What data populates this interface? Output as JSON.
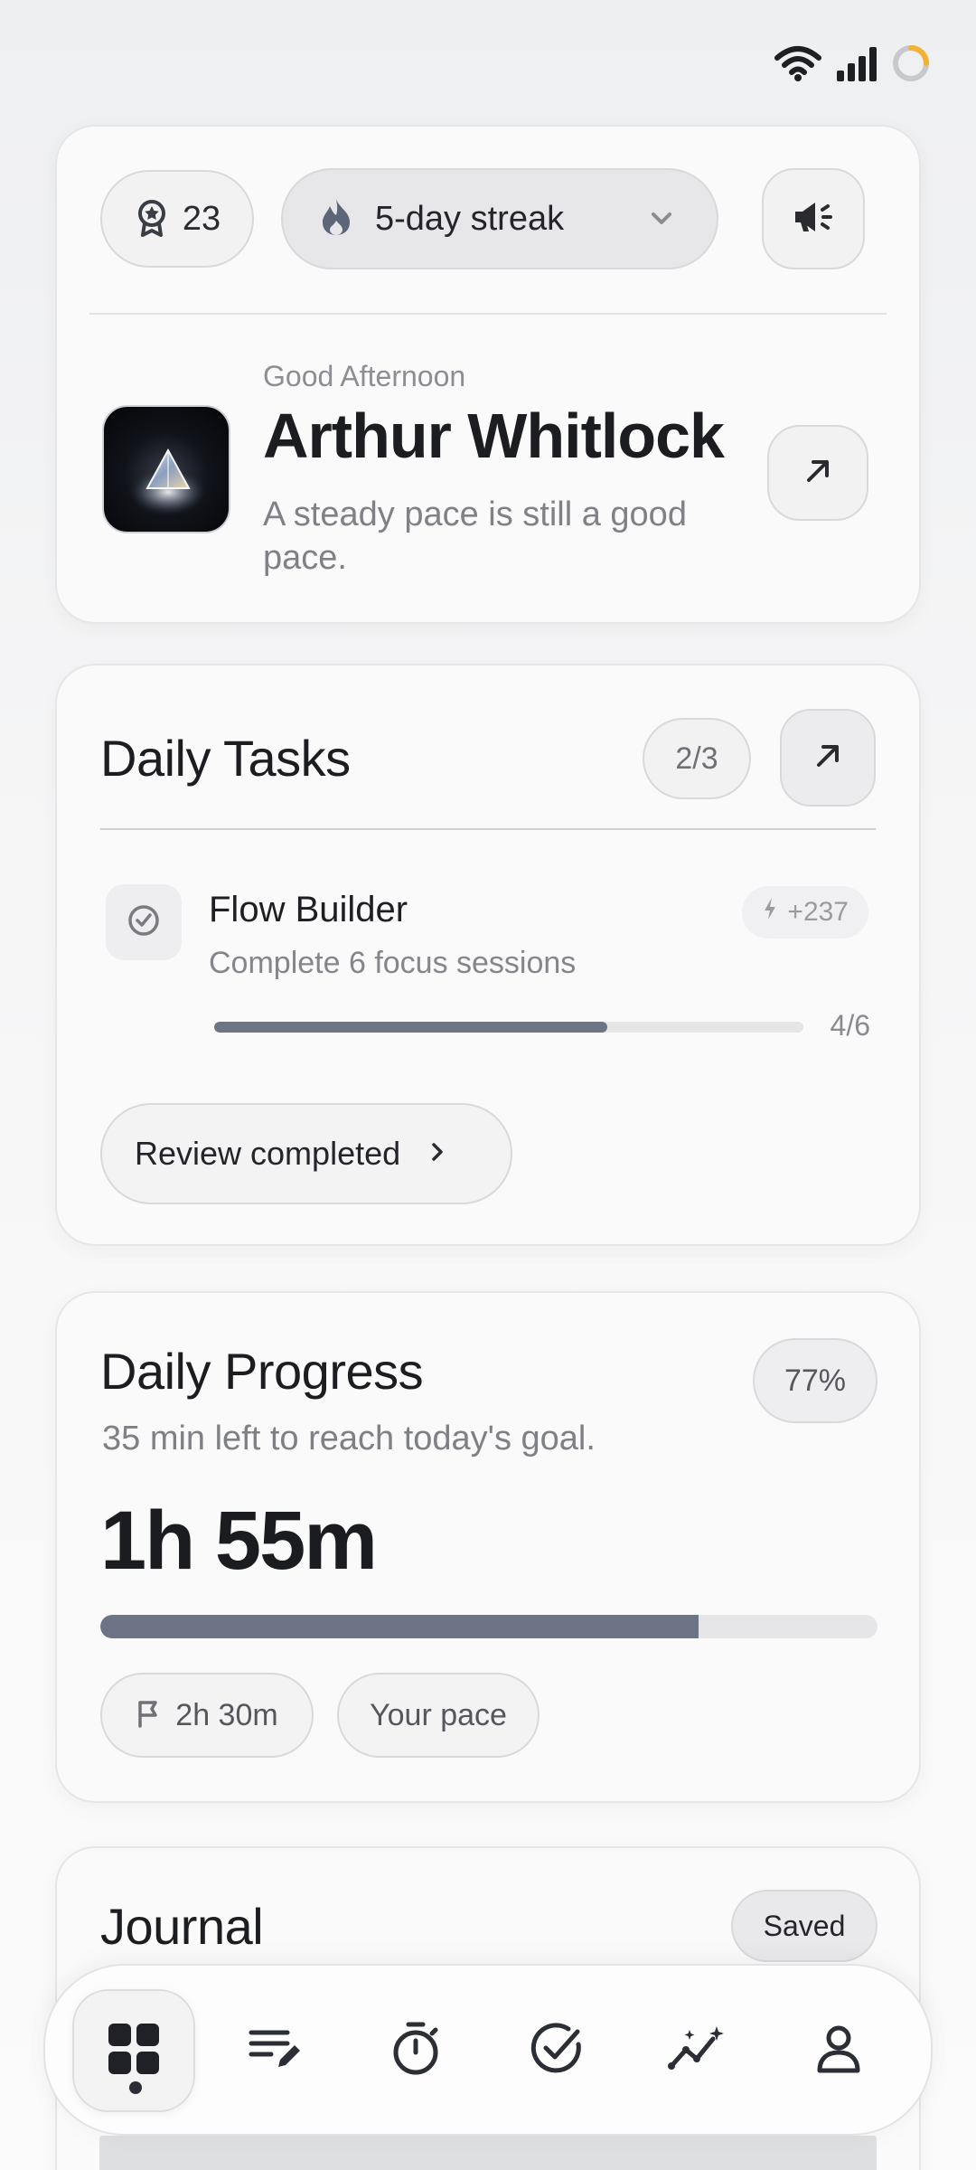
{
  "status_bar": {
    "wifi_icon": "wifi-icon",
    "signal_icon": "signal-icon",
    "battery_icon": "battery-ring-icon"
  },
  "header": {
    "points": "23",
    "streak_label": "5-day streak",
    "greeting": "Good Afternoon",
    "name": "Arthur Whitlock",
    "tagline": "A steady pace is still a good pace."
  },
  "daily_tasks": {
    "title": "Daily Tasks",
    "count": "2/3",
    "task": {
      "name": "Flow Builder",
      "description": "Complete 6 focus sessions",
      "xp": "+237",
      "progress_text": "4/6",
      "progress": 0.667
    },
    "review_label": "Review completed"
  },
  "daily_progress": {
    "title": "Daily Progress",
    "percent": "77%",
    "subtitle": "35 min left to reach today's goal.",
    "time": "1h 55m",
    "progress": 0.77,
    "goal": "2h 30m",
    "pace_label": "Your pace"
  },
  "journal": {
    "title": "Journal",
    "status": "Saved"
  },
  "nav": {
    "items": [
      "dashboard",
      "journal",
      "timer",
      "tasks",
      "insights",
      "profile"
    ],
    "active": "dashboard"
  },
  "colors": {
    "accent": "#6c7486",
    "text": "#1e1f22",
    "muted": "#85868b"
  }
}
